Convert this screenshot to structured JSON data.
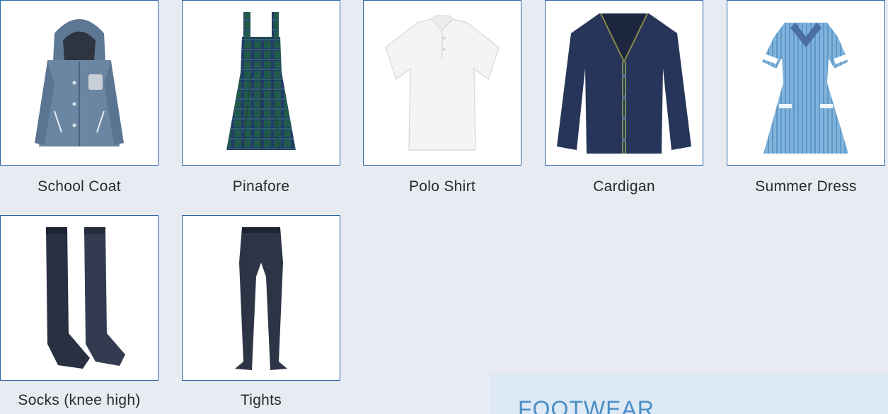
{
  "products": [
    {
      "name": "School Coat",
      "image": "school-coat-image"
    },
    {
      "name": "Pinafore",
      "image": "pinafore-image"
    },
    {
      "name": "Polo Shirt",
      "image": "polo-shirt-image"
    },
    {
      "name": "Cardigan",
      "image": "cardigan-image"
    },
    {
      "name": "Summer Dress",
      "image": "summer-dress-image"
    },
    {
      "name": "Socks (knee high)",
      "image": "socks-image"
    },
    {
      "name": "Tights",
      "image": "tights-image"
    }
  ],
  "footwear": {
    "title": "FOOTWEAR"
  },
  "colors": {
    "background": "#e8ecf2",
    "card_border": "#2c64a6",
    "label_text": "#2a2a2a",
    "footwear_panel": "#dde9f4",
    "footwear_title": "#4a8fc6"
  }
}
